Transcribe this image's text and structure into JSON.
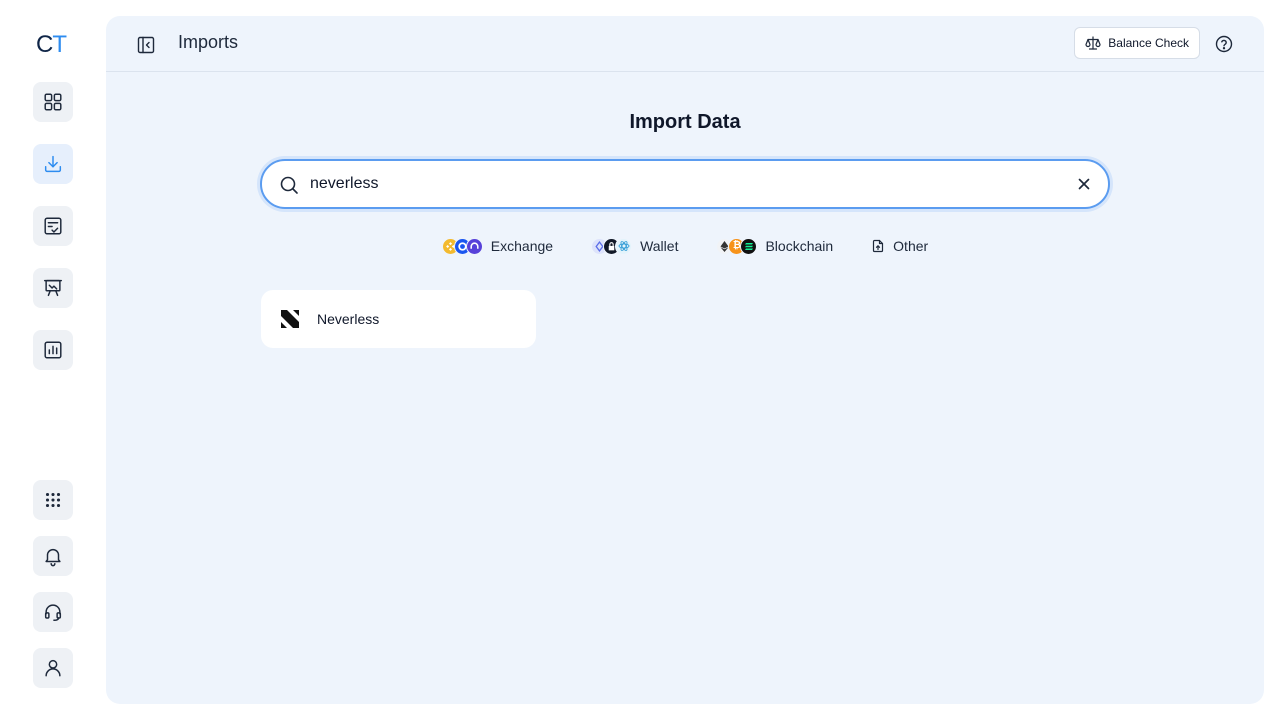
{
  "logo": {
    "c": "C",
    "t": "T"
  },
  "header": {
    "title": "Imports",
    "balance_check_label": "Balance Check"
  },
  "main": {
    "title": "Import Data",
    "search": {
      "value": "neverless",
      "placeholder": ""
    },
    "filters": [
      {
        "label": "Exchange"
      },
      {
        "label": "Wallet"
      },
      {
        "label": "Blockchain"
      },
      {
        "label": "Other"
      }
    ],
    "results": [
      {
        "label": "Neverless"
      }
    ]
  },
  "sidebar": {
    "items": [
      {
        "icon": "dashboard-grid-icon"
      },
      {
        "icon": "download-icon",
        "active": true
      },
      {
        "icon": "checklist-icon"
      },
      {
        "icon": "presentation-icon"
      },
      {
        "icon": "report-chart-icon"
      },
      {
        "icon": "apps-grid-icon"
      },
      {
        "icon": "bell-icon"
      },
      {
        "icon": "headset-icon"
      },
      {
        "icon": "user-icon"
      }
    ]
  },
  "colors": {
    "accent": "#2d8cf0",
    "main_bg": "#eef4fc",
    "search_border": "#5b9cf0"
  }
}
